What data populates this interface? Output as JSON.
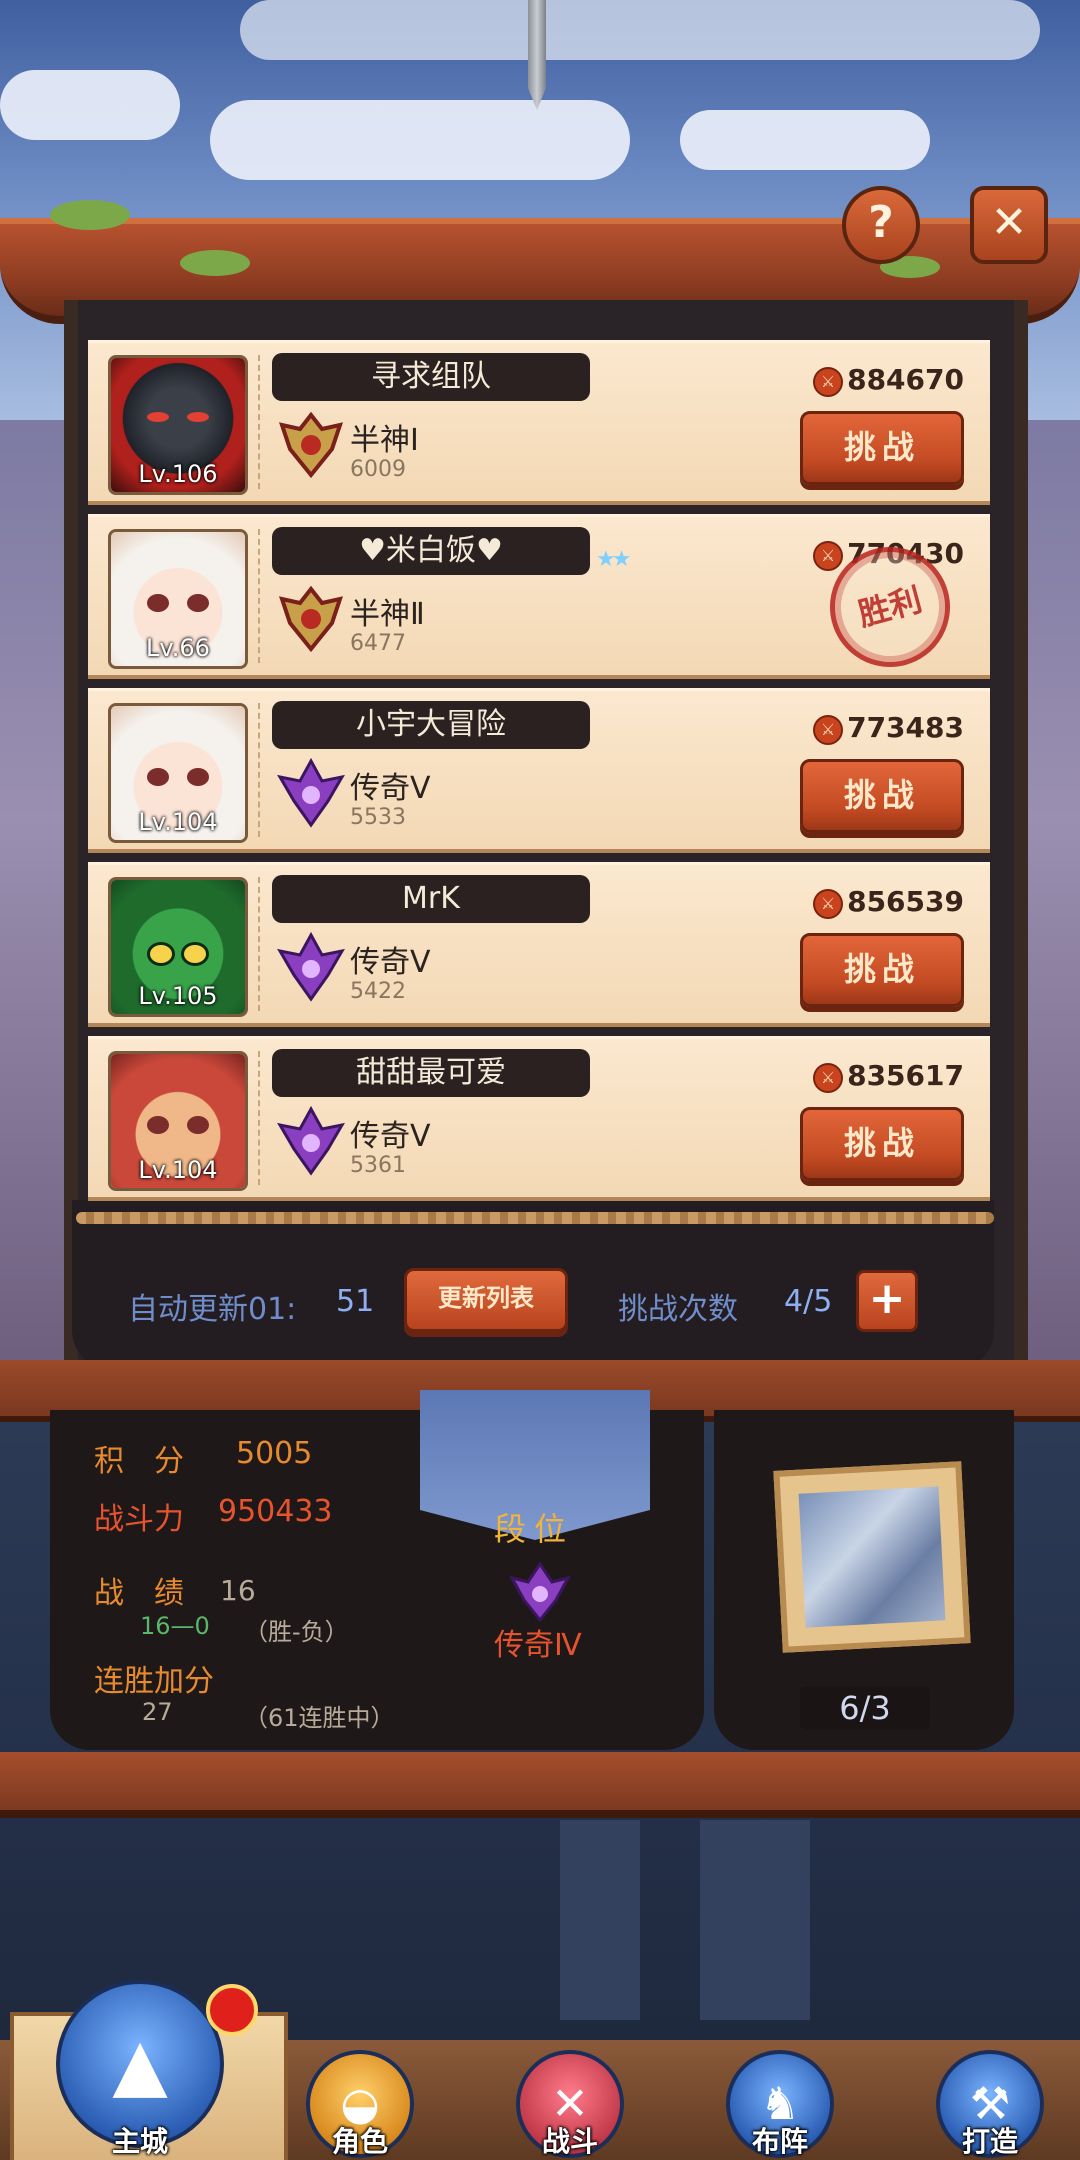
{
  "header": {
    "help_icon": "question-icon",
    "close_icon": "close-icon",
    "help_label": "?",
    "close_label": "✕"
  },
  "opponents": [
    {
      "name": "寻求组队",
      "level": "Lv.106",
      "rank": "半神Ⅰ",
      "rank_score": "6009",
      "power": "884670",
      "action": "挑战",
      "avatar": "armored-knight",
      "status": ""
    },
    {
      "name": "♥米白饭♥",
      "level": "Lv.66",
      "rank": "半神Ⅱ",
      "rank_score": "6477",
      "power": "770430",
      "action": "",
      "avatar": "white-haired-girl",
      "status": "胜利",
      "stars": "★★"
    },
    {
      "name": "小宇大冒险",
      "level": "Lv.104",
      "rank": "传奇Ⅴ",
      "rank_score": "5533",
      "power": "773483",
      "action": "挑战",
      "avatar": "white-haired-girl",
      "status": ""
    },
    {
      "name": "MrK",
      "level": "Lv.105",
      "rank": "传奇Ⅴ",
      "rank_score": "5422",
      "power": "856539",
      "action": "挑战",
      "avatar": "green-dinosaur",
      "status": ""
    },
    {
      "name": "甜甜最可爱",
      "level": "Lv.104",
      "rank": "传奇Ⅴ",
      "rank_score": "5361",
      "power": "835617",
      "action": "挑战",
      "avatar": "red-haired-boy",
      "status": ""
    }
  ],
  "footer": {
    "auto_refresh_label": "自动更新01:",
    "auto_refresh_value": "51",
    "refresh_button": "更新列表",
    "challenge_count_label": "挑战次数",
    "challenge_count_value": "4/5",
    "plus_label": "+"
  },
  "stats": {
    "score_label": "积　分",
    "score_value": "5005",
    "combat_label": "战斗力",
    "combat_value": "950433",
    "record_label": "战　绩",
    "record_value": "16",
    "record_detail": "16—0",
    "record_hint": "（胜-负）",
    "streak_label": "连胜加分",
    "streak_value": "27",
    "streak_hint": "（61连胜中）",
    "rank_title": "段位",
    "rank_name": "传奇Ⅳ",
    "trophy_count": "6/3"
  },
  "nav": [
    {
      "label": "主城",
      "icon": "castle-icon"
    },
    {
      "label": "角色",
      "icon": "knight-helmet-icon"
    },
    {
      "label": "战斗",
      "icon": "crossed-swords-icon"
    },
    {
      "label": "布阵",
      "icon": "formation-icon"
    },
    {
      "label": "打造",
      "icon": "forge-icon"
    }
  ],
  "colors": {
    "accent": "#c24a22",
    "row_bg": "#fbe8cf",
    "win_stamp": "#b8231f",
    "footer_text": "#6f8dc9"
  }
}
